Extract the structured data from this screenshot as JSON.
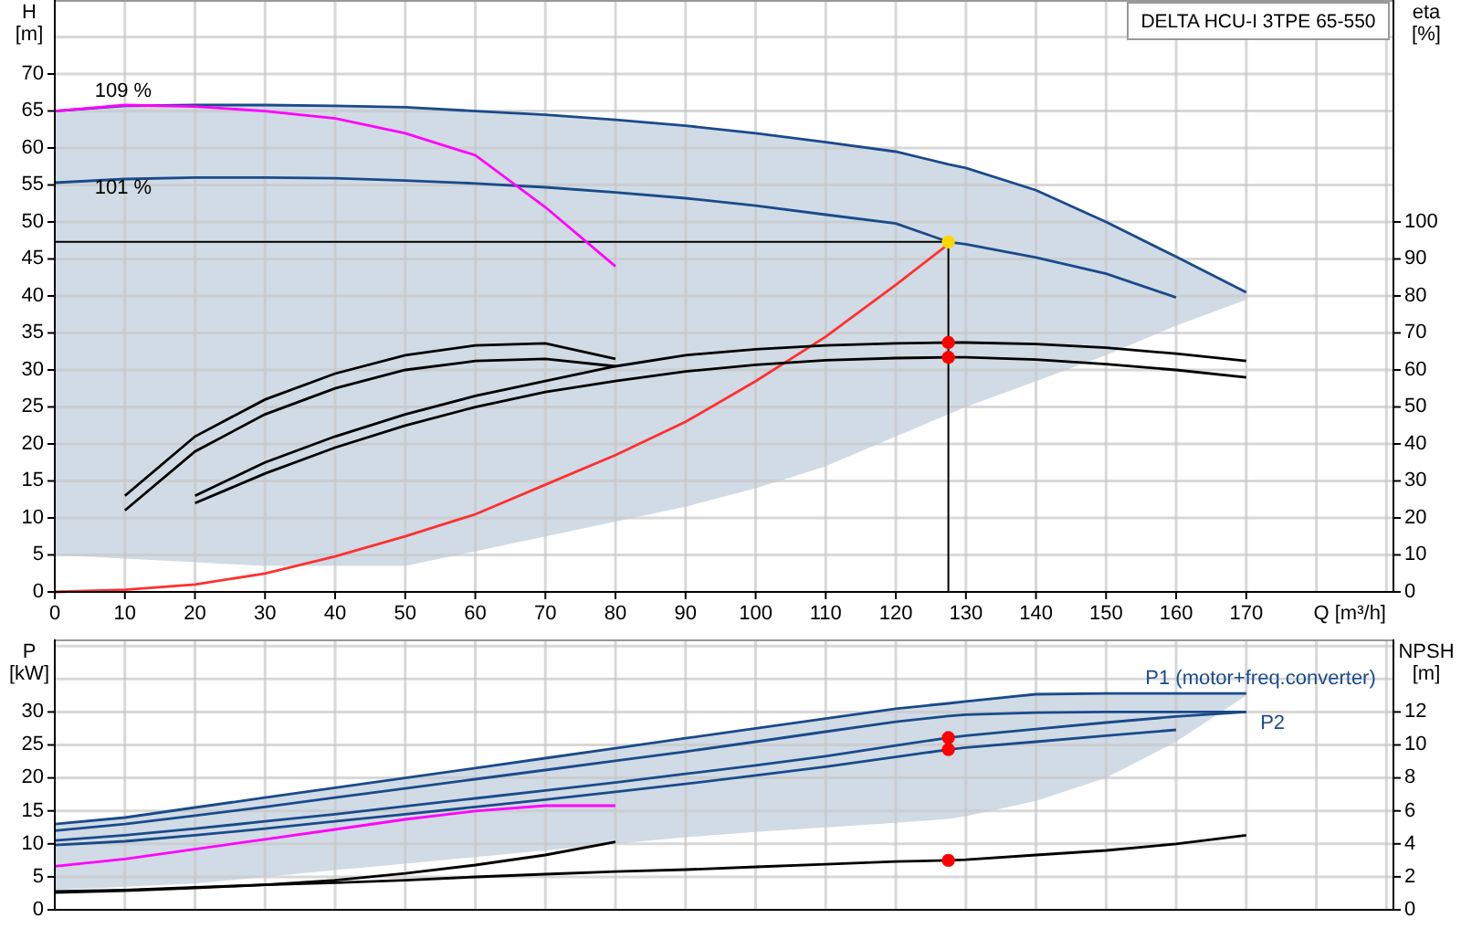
{
  "charts": [
    {
      "y_unit": "[m]",
      "right_axis": {
        "title": "eta",
        "unit": "[%]",
        "ticks": [
          "100",
          "90",
          "80",
          "70",
          "60",
          "50",
          "40",
          "30",
          "20",
          "10",
          "0"
        ]
      },
      "chart_data": {
        "type": "line",
        "title": "DELTA HCU-I 3TPE 65-550",
        "xlabel": "Q [m³/h]",
        "ylabel": "H",
        "xlim": [
          0,
          191
        ],
        "ylim": [
          0,
          80
        ],
        "grid": true,
        "xticks": [
          0,
          10,
          20,
          30,
          40,
          50,
          60,
          70,
          80,
          90,
          100,
          110,
          120,
          130,
          140,
          150,
          160,
          170
        ],
        "yticks": [
          0,
          5,
          10,
          15,
          20,
          25,
          30,
          35,
          40,
          45,
          50,
          55,
          60,
          65,
          70
        ],
        "x": [
          0,
          10,
          20,
          30,
          40,
          50,
          60,
          70,
          80,
          90,
          100,
          110,
          120,
          127.5,
          130,
          140,
          150,
          160,
          170
        ],
        "series": [
          {
            "type": "area",
            "color": "#d0dbe6",
            "values": [
              65,
              65.7,
              65.8,
              65.8,
              65.7,
              65.5,
              65,
              64.5,
              63.8,
              63,
              62,
              60.8,
              59.5,
              57.8,
              57.3,
              54.3,
              50,
              45.3,
              40.5
            ]
          },
          {
            "color": "#1a4a8a",
            "values": [
              55.3,
              55.8,
              56,
              56,
              55.9,
              55.6,
              55.2,
              54.7,
              54,
              53.2,
              52.2,
              51,
              49.8,
              47.3,
              47,
              45.2,
              43,
              39.8,
              null
            ]
          },
          {
            "color": "#ff00ff",
            "values": [
              65,
              65.8,
              65.6,
              65,
              64,
              62,
              59,
              52,
              44,
              null,
              null,
              null,
              null,
              null,
              null,
              null,
              null,
              null,
              null
            ]
          },
          {
            "color": "#ff3030",
            "values": [
              0,
              0.3,
              1,
              2.5,
              4.8,
              7.5,
              10.5,
              14.5,
              18.5,
              23,
              28.5,
              34.5,
              41.5,
              47,
              null,
              null,
              null,
              null,
              null
            ]
          },
          {
            "color": "#000000",
            "values": [
              null,
              13,
              21,
              26,
              29.5,
              32,
              33.3,
              33.6,
              31.5,
              null,
              null,
              null,
              null,
              null,
              null,
              null,
              null,
              null,
              null
            ]
          },
          {
            "color": "#000000",
            "values": [
              null,
              11,
              19,
              24,
              27.5,
              30,
              31.2,
              31.5,
              30.5,
              null,
              null,
              null,
              null,
              null,
              null,
              null,
              null,
              null,
              null
            ]
          },
          {
            "color": "#000000",
            "values": [
              null,
              null,
              13,
              17.5,
              21,
              24,
              26.5,
              28.5,
              30.5,
              32,
              32.8,
              33.3,
              33.6,
              33.7,
              33.7,
              33.5,
              33,
              32.2,
              31.2
            ]
          },
          {
            "color": "#000000",
            "values": [
              null,
              null,
              12,
              16,
              19.5,
              22.5,
              25,
              27,
              28.5,
              29.8,
              30.7,
              31.3,
              31.6,
              31.7,
              31.7,
              31.4,
              30.8,
              30,
              29
            ]
          },
          {
            "type": "scatter",
            "color": "#ffd700",
            "values": [
              null,
              null,
              null,
              null,
              null,
              null,
              null,
              null,
              null,
              null,
              null,
              null,
              null,
              47.3,
              null,
              null,
              null,
              null,
              null
            ]
          },
          {
            "type": "scatter",
            "color": "#ff0000",
            "values": [
              null,
              null,
              null,
              null,
              null,
              null,
              null,
              null,
              null,
              null,
              null,
              null,
              null,
              33.7,
              null,
              null,
              null,
              null,
              null
            ]
          },
          {
            "type": "scatter",
            "color": "#ff0000",
            "values": [
              null,
              null,
              null,
              null,
              null,
              null,
              null,
              null,
              null,
              null,
              null,
              null,
              null,
              31.7,
              null,
              null,
              null,
              null,
              null
            ]
          },
          {
            "type": "area",
            "color": "#ffffff",
            "values": [
              5,
              4.5,
              4,
              3.5,
              3.5,
              3.5,
              5.5,
              7.5,
              9.5,
              11.5,
              14,
              17,
              21,
              24,
              25,
              28.5,
              32,
              36,
              39.5
            ]
          }
        ],
        "ref_lines": [
          {
            "axis": "y",
            "value": 47.3
          },
          {
            "axis": "x",
            "value": 127.5
          }
        ],
        "annotations": [
          "109 %",
          "101 %"
        ]
      }
    },
    {
      "y_unit": "[kW]",
      "right_axis": {
        "title": "NPSH",
        "unit": "[m]",
        "ticks": [
          "12",
          "10",
          "8",
          "6",
          "4",
          "2",
          "0"
        ]
      },
      "chart_data": {
        "type": "line",
        "ylabel": "P",
        "xlim": [
          0,
          191
        ],
        "ylim": [
          0,
          41
        ],
        "grid": true,
        "yticks": [
          0,
          5,
          10,
          15,
          20,
          25,
          30
        ],
        "x": [
          0,
          10,
          20,
          30,
          40,
          50,
          60,
          70,
          80,
          90,
          100,
          110,
          120,
          127.5,
          130,
          140,
          150,
          160,
          170
        ],
        "series": [
          {
            "type": "area",
            "color": "#d0dbe6",
            "values": [
              13,
              14,
              15.5,
              17,
              18.5,
              20,
              21.5,
              23,
              24.5,
              26,
              27.5,
              29,
              30.5,
              31.3,
              31.6,
              32.7,
              32.8,
              32.8,
              32.8
            ]
          },
          {
            "color": "#1a4a8a",
            "values": [
              12,
              13,
              14.3,
              15.6,
              17,
              18.4,
              19.8,
              21.2,
              22.6,
              24,
              25.5,
              27,
              28.5,
              29.4,
              29.6,
              29.9,
              30,
              30,
              30
            ]
          },
          {
            "color": "#1a4a8a",
            "values": [
              10.5,
              11.3,
              12.3,
              13.4,
              14.5,
              15.7,
              16.9,
              18.1,
              19.3,
              20.6,
              21.9,
              23.3,
              24.9,
              26.1,
              26.4,
              27.4,
              28.4,
              29.3,
              30
            ]
          },
          {
            "color": "#1a4a8a",
            "values": [
              9.8,
              10.4,
              11.3,
              12.3,
              13.4,
              14.5,
              15.6,
              16.7,
              17.9,
              19.1,
              20.4,
              21.7,
              23.2,
              24.3,
              24.6,
              25.5,
              26.4,
              27.3,
              null
            ]
          },
          {
            "color": "#ff00ff",
            "values": [
              6.6,
              7.7,
              9.2,
              10.7,
              12.2,
              13.7,
              15,
              15.8,
              15.8,
              null,
              null,
              null,
              null,
              null,
              null,
              null,
              null,
              null,
              null
            ]
          },
          {
            "color": "#000000",
            "values": [
              2.8,
              3,
              3.4,
              3.8,
              4.1,
              4.5,
              5,
              5.4,
              5.8,
              6.1,
              6.5,
              6.9,
              7.3,
              7.5,
              7.6,
              8.3,
              9,
              10,
              11.3
            ]
          },
          {
            "color": "#000000",
            "values": [
              2.6,
              2.9,
              3.3,
              3.8,
              4.5,
              5.5,
              6.8,
              8.3,
              10.3,
              null,
              null,
              null,
              null,
              null,
              null,
              null,
              null,
              null,
              null
            ]
          },
          {
            "type": "scatter",
            "color": "#ff0000",
            "values": [
              null,
              null,
              null,
              null,
              null,
              null,
              null,
              null,
              null,
              null,
              null,
              null,
              null,
              26.1,
              null,
              null,
              null,
              null,
              null
            ]
          },
          {
            "type": "scatter",
            "color": "#ff0000",
            "values": [
              null,
              null,
              null,
              null,
              null,
              null,
              null,
              null,
              null,
              null,
              null,
              null,
              null,
              24.3,
              null,
              null,
              null,
              null,
              null
            ]
          },
          {
            "type": "scatter",
            "color": "#ff0000",
            "values": [
              null,
              null,
              null,
              null,
              null,
              null,
              null,
              null,
              null,
              null,
              null,
              null,
              null,
              7.5,
              null,
              null,
              null,
              null,
              null
            ]
          },
          {
            "type": "area",
            "color": "#ffffff",
            "values": [
              3,
              3.5,
              4,
              5,
              6,
              7,
              8,
              9,
              10,
              11,
              11.8,
              12.5,
              13.2,
              13.8,
              14.2,
              16.5,
              20,
              25.5,
              32.5
            ]
          }
        ],
        "annotations": [
          "P1 (motor+freq.converter)",
          "P2"
        ]
      }
    }
  ]
}
